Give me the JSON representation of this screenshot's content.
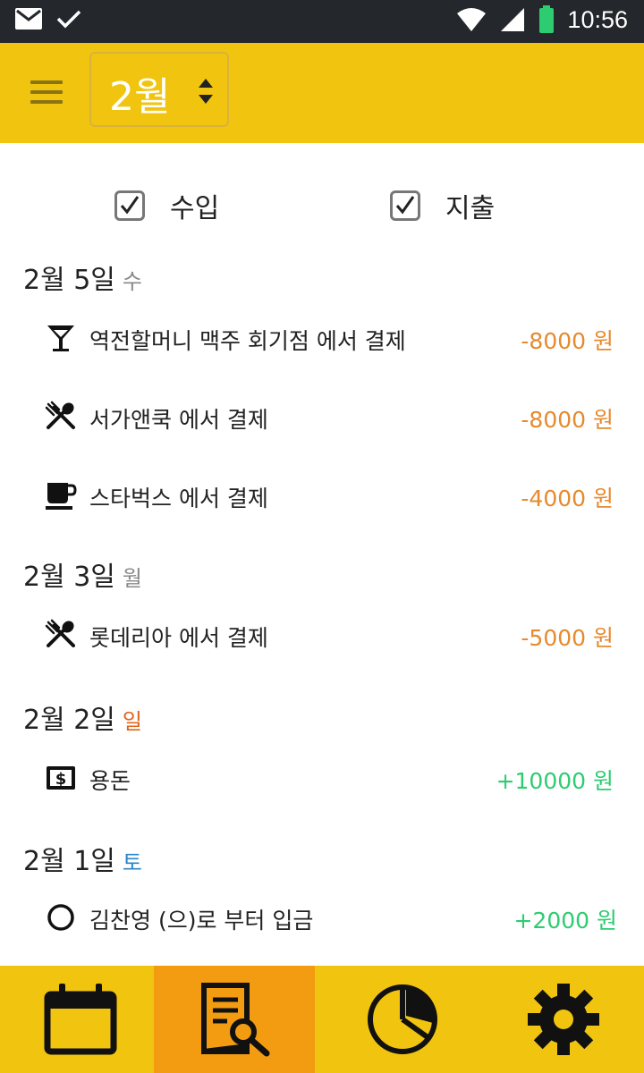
{
  "status_bar": {
    "time": "10:56"
  },
  "app_bar": {
    "month_label": "2월"
  },
  "filters": {
    "income": {
      "label": "수입",
      "checked": true
    },
    "expense": {
      "label": "지출",
      "checked": true
    }
  },
  "days": [
    {
      "date": "2월 5일",
      "weekday": "수",
      "weekday_color": "#888888",
      "items": [
        {
          "icon": "cocktail-icon",
          "title": "역전할머니 맥주 회기점 에서 결제",
          "amount": "-8000 원"
        },
        {
          "icon": "restaurant-icon",
          "title": "서가앤쿡 에서 결제",
          "amount": "-8000 원"
        },
        {
          "icon": "coffee-icon",
          "title": "스타벅스 에서 결제",
          "amount": "-4000 원"
        }
      ]
    },
    {
      "date": "2월 3일",
      "weekday": "월",
      "weekday_color": "#888888",
      "items": [
        {
          "icon": "restaurant-icon",
          "title": "롯데리아 에서 결제",
          "amount": "-5000 원"
        }
      ]
    },
    {
      "date": "2월 2일",
      "weekday": "일",
      "weekday_color": "#e0641a",
      "items": [
        {
          "icon": "money-icon",
          "title": "용돈",
          "amount": "+10000 원"
        }
      ]
    },
    {
      "date": "2월 1일",
      "weekday": "토",
      "weekday_color": "#2a86c8",
      "items": [
        {
          "icon": "circle-icon",
          "title": "김찬영 (으)로 부터 입금",
          "amount": "+2000 원"
        }
      ]
    }
  ],
  "colors": {
    "expense": "#e68a2e",
    "income": "#2ecc71",
    "primary": "#f1c40f",
    "active_tab": "#f39c12"
  },
  "bottom_nav": [
    {
      "icon": "calendar-icon",
      "active": false
    },
    {
      "icon": "search-document-icon",
      "active": true
    },
    {
      "icon": "pie-chart-icon",
      "active": false
    },
    {
      "icon": "gear-icon",
      "active": false
    }
  ]
}
